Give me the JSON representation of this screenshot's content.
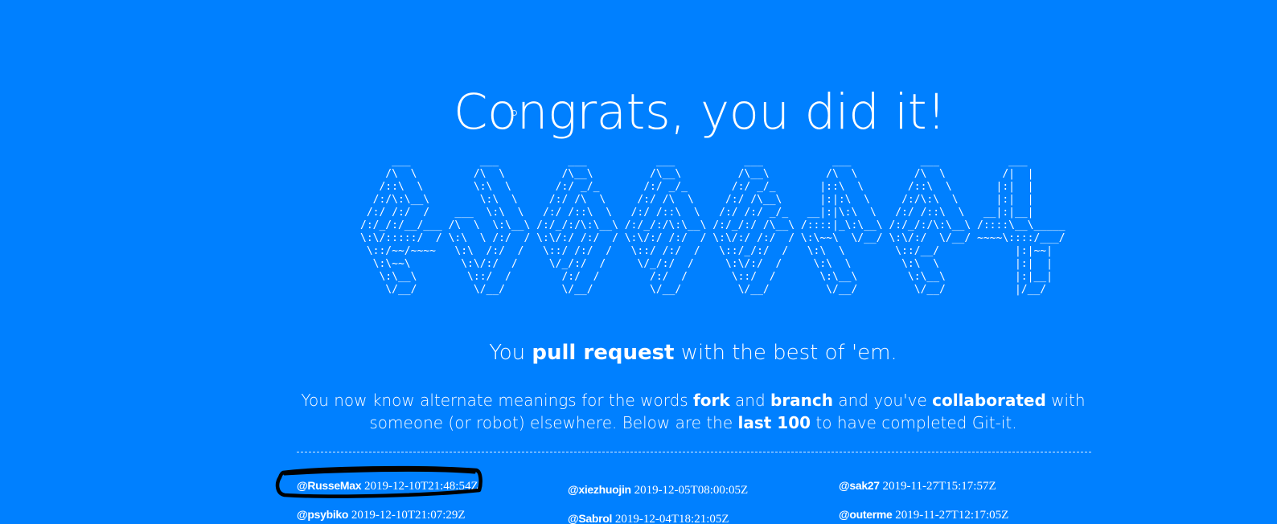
{
  "title": "Congrats, you did it!",
  "ascii_art": "     ___           ___           ___           ___           ___           ___           ___           ___     \n    /\\  \\         /\\  \\         /\\__\\         /\\__\\         /\\__\\         /\\  \\         /\\  \\         /|  |    \n   /::\\  \\        \\:\\  \\       /:/ _/_       /:/ _/_       /:/ _/_       |::\\  \\       /::\\  \\       |:|  |    \n  /:/\\:\\__\\        \\:\\  \\     /:/ /\\  \\     /:/ /\\  \\     /:/ /\\__\\      |:|:\\  \\     /:/\\:\\  \\      |:|  |    \n /:/ /:/  /    ___  \\:\\  \\   /:/ /::\\  \\   /:/ /::\\  \\   /:/ /:/ _/_   __|:|\\:\\  \\   /:/ /::\\  \\   __|:|__|    \n/:/_/:/__/___ /\\  \\  \\:\\__\\ /:/_/:/\\:\\__\\ /:/_/:/\\:\\__\\ /:/_/:/ /\\__\\ /::::|_\\:\\__\\ /:/_/:/\\:\\__\\ /::::\\__\\_____\n\\:\\/:::::/  / \\:\\  \\ /:/  / \\:\\/:/ /:/  / \\:\\/:/ /:/  / \\:\\/:/ /:/  / \\:\\~~\\  \\/__/ \\:\\/:/  \\/__/ ~~~~\\::::/___/\n \\::/~~/~~~~   \\:\\  /:/  /   \\::/ /:/  /   \\::/ /:/  /   \\::/_/:/  /   \\:\\  \\        \\::/__/            |:|~~|    \n  \\:\\~~\\        \\:\\/:/  /     \\/_/:/  /     \\/_/:/  /     \\:\\/:/  /     \\:\\  \\        \\:\\  \\            |:|  |    \n   \\:\\__\\        \\::/  /        /:/  /        /:/  /       \\::/  /       \\:\\__\\        \\:\\__\\           |:|__|    \n    \\/__/         \\/__/         \\/__/         \\/__/         \\/__/         \\/__/         \\/__/           |/__/     ",
  "tagline": {
    "pre": "You ",
    "strong": "pull request",
    "post": " with the best of 'em."
  },
  "description": {
    "p1": "You now know alternate meanings for the words ",
    "b1": "fork",
    "p2": " and ",
    "b2": "branch",
    "p3": " and you've ",
    "b3": "collaborated",
    "p4": " with someone (or robot) elsewhere. Below are the ",
    "b4": "last 100",
    "p5": " to have completed Git-it."
  },
  "completers": [
    {
      "user": "@RusseMax",
      "timestamp": "2019-12-10T21:48:54Z"
    },
    {
      "user": "@xiezhuojin",
      "timestamp": "2019-12-05T08:00:05Z"
    },
    {
      "user": "@sak27",
      "timestamp": "2019-11-27T15:17:57Z"
    },
    {
      "user": "@psybiko",
      "timestamp": "2019-12-10T21:07:29Z"
    },
    {
      "user": "@Sabrol",
      "timestamp": "2019-12-04T18:21:05Z"
    },
    {
      "user": "@outerme",
      "timestamp": "2019-11-27T12:17:05Z"
    }
  ],
  "colors": {
    "background": "#0080ff",
    "text": "#ffffff",
    "scribble": "#000000"
  }
}
